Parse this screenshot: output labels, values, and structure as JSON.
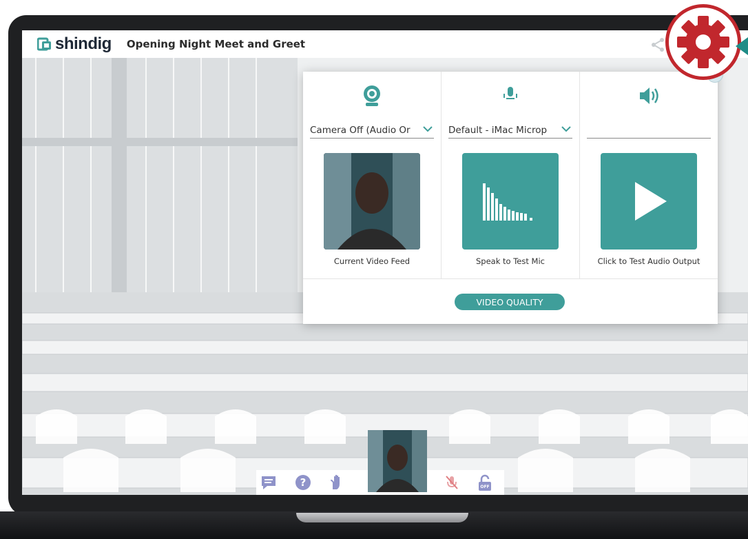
{
  "app": {
    "brand": "shindig",
    "event_title": "Opening Night Meet and Greet"
  },
  "settings_panel": {
    "columns": [
      {
        "icon": "webcam-icon",
        "select_value": "Camera Off (Audio Or",
        "caption": "Current Video Feed"
      },
      {
        "icon": "microphone-icon",
        "select_value": "Default - iMac Microp",
        "caption": "Speak to Test Mic"
      },
      {
        "icon": "speaker-icon",
        "select_value": "",
        "caption": "Click to Test Audio Output"
      }
    ],
    "video_quality_label": "VIDEO QUALITY"
  },
  "toolbar": {
    "icons": [
      "chat-icon",
      "help-icon",
      "raise-hand-icon",
      "mic-muted-icon",
      "lock-icon"
    ],
    "lock_badge": "OFF"
  },
  "colors": {
    "accent": "#3f9e9a",
    "highlight": "#c1272d",
    "arrow": "#1f8c87"
  }
}
